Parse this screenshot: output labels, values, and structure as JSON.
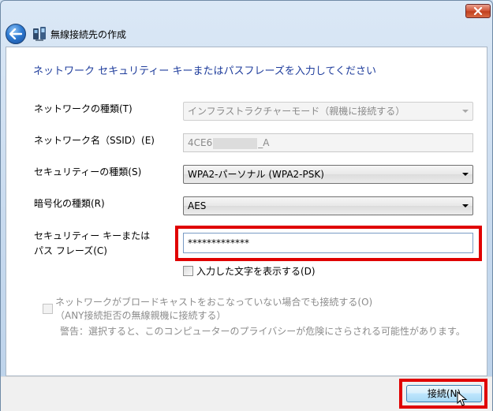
{
  "window": {
    "title": "無線接続先の作成",
    "close_icon": "close-icon",
    "back_icon": "back-arrow-icon"
  },
  "instruction": "ネットワーク セキュリティー キーまたはパスフレーズを入力してください",
  "form": {
    "network_type_label": "ネットワークの種類(T)",
    "network_type_value": "インフラストラクチャーモード（親機に接続する）",
    "ssid_label": "ネットワーク名（SSID）(E)",
    "ssid_prefix": "4CE6",
    "ssid_suffix": "_A",
    "security_type_label": "セキュリティーの種類(S)",
    "security_type_value": "WPA2-パーソナル (WPA2-PSK)",
    "encryption_label": "暗号化の種類(R)",
    "encryption_value": "AES",
    "key_label_line1": "セキュリティー キーまたは",
    "key_label_line2": "パス フレーズ(C)",
    "key_value": "*************",
    "show_chars_label": "入力した文字を表示する(D)"
  },
  "broadcast": {
    "line1": "ネットワークがブロードキャストをおこなっていない場合でも接続する(O)",
    "line2": "（ANY接続拒否の無線親機に接続する）",
    "warning": "警告：選択すると、このコンピューターのプライバシーが危険にさらされる可能性があります。"
  },
  "footer": {
    "connect_label": "接続(N)"
  },
  "colors": {
    "instruction": "#1f3d9c",
    "highlight": "#e00000"
  }
}
